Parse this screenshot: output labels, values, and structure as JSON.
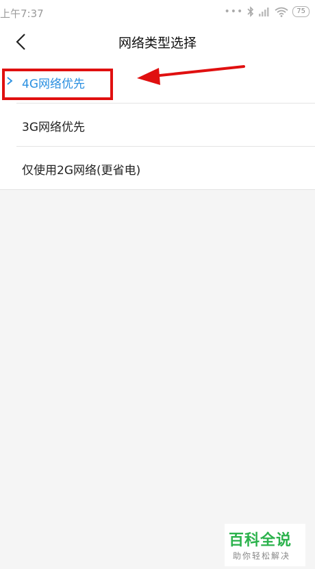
{
  "status_bar": {
    "time": "上午7:37",
    "battery": "75"
  },
  "header": {
    "title": "网络类型选择"
  },
  "network_options": [
    {
      "label": "4G网络优先",
      "selected": true
    },
    {
      "label": "3G网络优先",
      "selected": false
    },
    {
      "label": "仅使用2G网络(更省电)",
      "selected": false
    }
  ],
  "watermark": {
    "logo": "百科全说",
    "subtitle": "助你轻松解决"
  },
  "colors": {
    "accent": "#2a8fe0",
    "annotation": "#e01010",
    "watermark": "#2bb24c"
  },
  "icons": [
    "back-chevron-icon",
    "bluetooth-icon",
    "signal-icon",
    "wifi-icon",
    "battery-icon",
    "selected-chevron-icon"
  ]
}
